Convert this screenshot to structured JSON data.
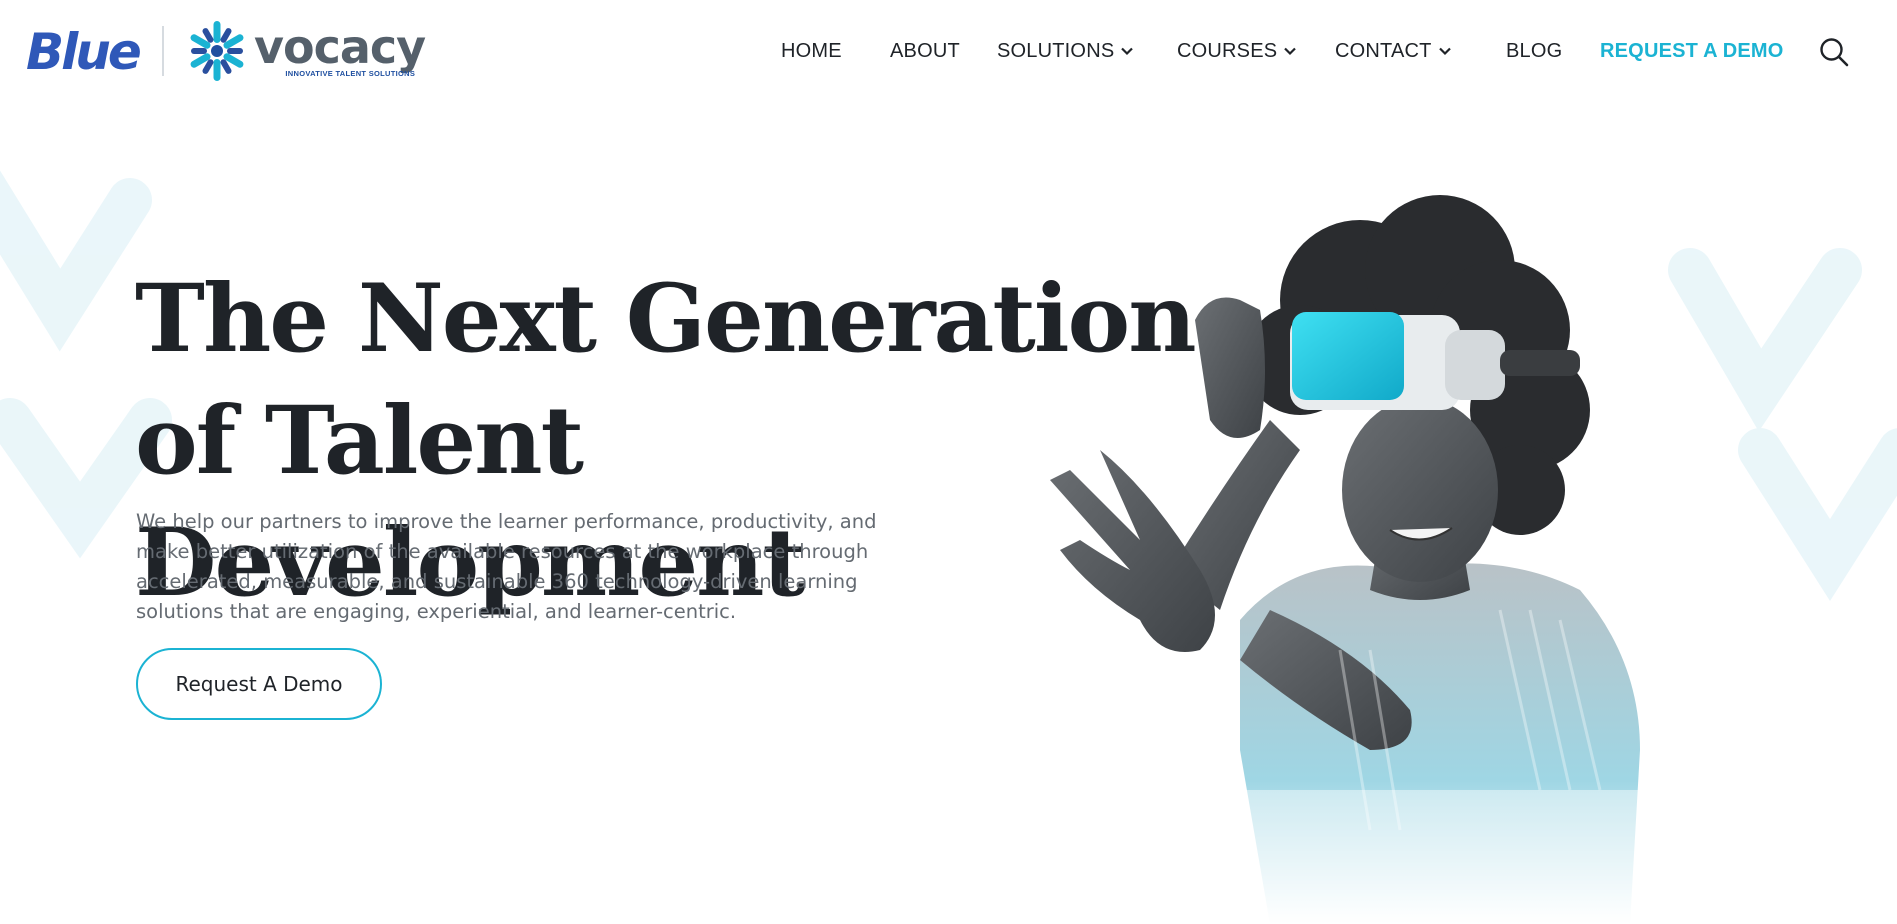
{
  "brand": {
    "primary_logo_text": "Blue",
    "partner_logo_text": "vocacy",
    "partner_tagline": "INNOVATIVE TALENT SOLUTIONS",
    "accent_color": "#1bb3d3",
    "logo_blue_color": "#2f58b8"
  },
  "nav": {
    "items": [
      {
        "label": "HOME",
        "has_dropdown": false
      },
      {
        "label": "ABOUT",
        "has_dropdown": false
      },
      {
        "label": "SOLUTIONS",
        "has_dropdown": true,
        "icon": "chevron-down-icon"
      },
      {
        "label": "COURSES",
        "has_dropdown": true,
        "icon": "chevron-down-icon"
      },
      {
        "label": "CONTACT",
        "has_dropdown": true,
        "icon": "chevron-down-icon"
      },
      {
        "label": "BLOG",
        "has_dropdown": false
      }
    ],
    "cta_label": "REQUEST A DEMO",
    "search_icon": "search-icon"
  },
  "hero": {
    "title_line1": "The Next Generation",
    "title_line2": "of Talent Development",
    "description": "We help our partners to improve the learner performance, productivity, and make better utilization of the available resources at the workplace through accelerated, measurable, and sustainable 360 technology-driven learning solutions that are engaging, experiential, and learner-centric.",
    "cta_label": "Request A Demo",
    "illustration": "woman-wearing-vr-headset"
  }
}
